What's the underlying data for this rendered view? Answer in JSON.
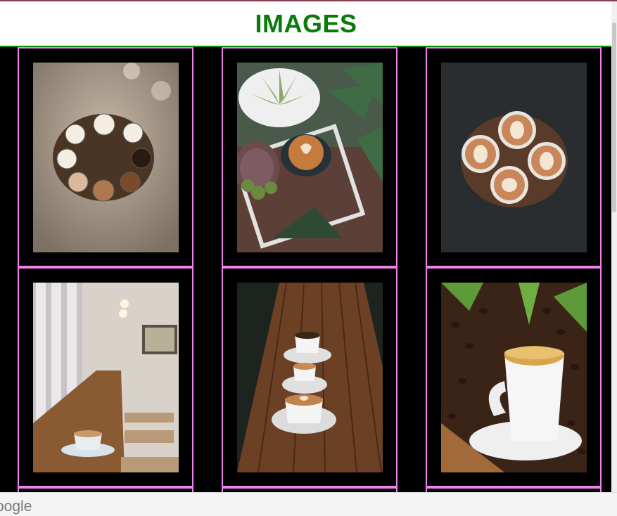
{
  "header": {
    "title": "IMAGES",
    "title_color": "#0a7a0a"
  },
  "card_border_color": "#ee82ee",
  "images": [
    {
      "name": "coffee-cups-round-table-image"
    },
    {
      "name": "latte-succulents-tray-image"
    },
    {
      "name": "four-latte-art-cups-image"
    },
    {
      "name": "cafe-window-counter-latte-image"
    },
    {
      "name": "three-coffees-wooden-bar-image"
    },
    {
      "name": "coffee-cup-beans-leaves-image"
    }
  ],
  "footer": {
    "brand_fragment": "oogle"
  }
}
